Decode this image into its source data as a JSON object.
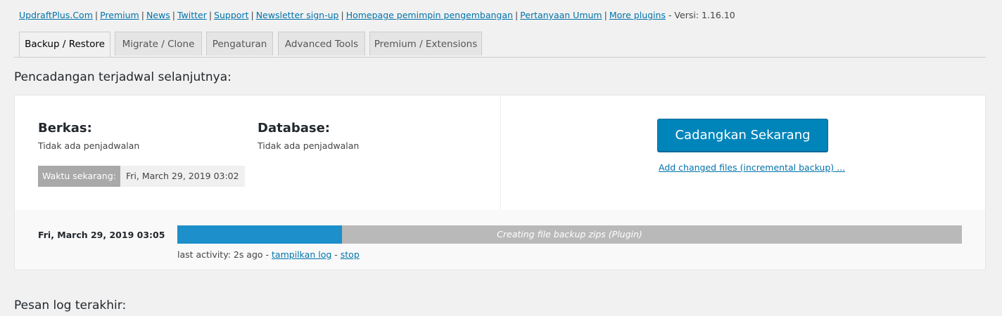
{
  "top_links": {
    "items": [
      "UpdraftPlus.Com",
      "Premium",
      "News",
      "Twitter",
      "Support",
      "Newsletter sign-up",
      "Homepage pemimpin pengembangan",
      "Pertanyaan Umum",
      "More plugins"
    ],
    "separator": "|",
    "version": "- Versi: 1.16.10"
  },
  "tabs": [
    {
      "label": "Backup / Restore",
      "active": true
    },
    {
      "label": "Migrate / Clone",
      "active": false
    },
    {
      "label": "Pengaturan",
      "active": false
    },
    {
      "label": "Advanced Tools",
      "active": false
    },
    {
      "label": "Premium / Extensions",
      "active": false
    }
  ],
  "next_scheduled": {
    "title": "Pencadangan terjadwal selanjutnya:",
    "files_label": "Berkas:",
    "files_value": "Tidak ada penjadwalan",
    "database_label": "Database:",
    "database_value": "Tidak ada penjadwalan",
    "current_time_label": "Waktu sekarang:",
    "current_time_value": "Fri, March 29, 2019 03:02",
    "backup_now_label": "Cadangkan Sekarang",
    "incremental_link": "Add changed files (incremental backup) ..."
  },
  "progress": {
    "date": "Fri, March 29, 2019 03:05",
    "status_text": "Creating file backup zips (Plugin)",
    "fraction_complete": 0.21,
    "activity_prefix": "last activity: 2s ago -",
    "show_log_label": "tampilkan log",
    "dash": "-",
    "stop_label": "stop"
  },
  "log": {
    "title": "Pesan log terakhir:"
  },
  "colors": {
    "primary_button": "#0085ba",
    "progress_fill": "#1d8fca",
    "progress_track": "#b9b9b9",
    "link": "#0073aa"
  }
}
